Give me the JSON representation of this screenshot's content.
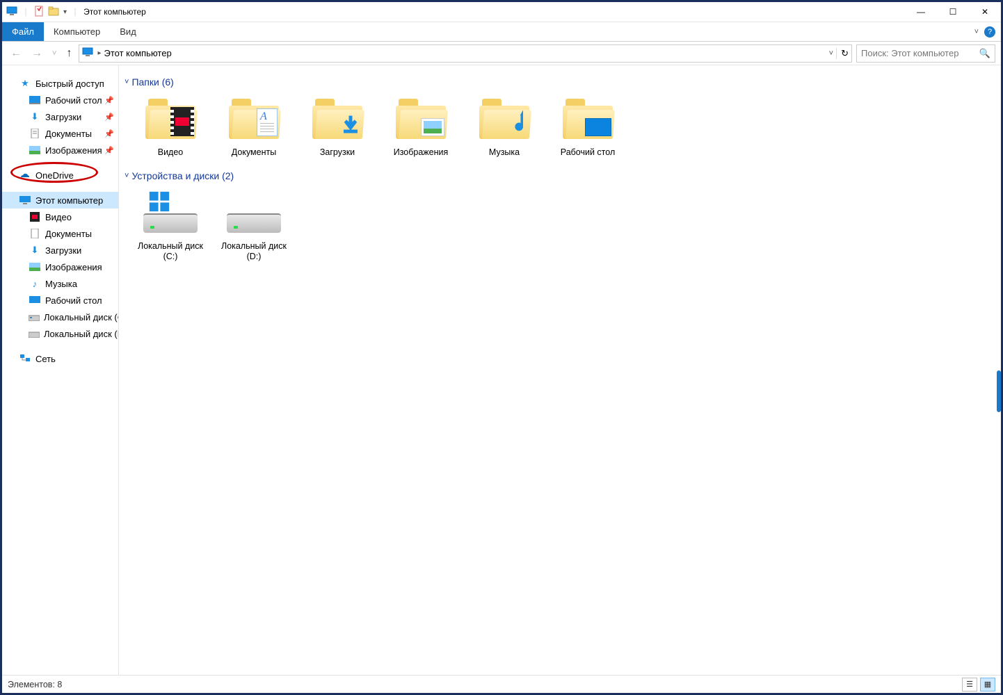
{
  "window": {
    "title": "Этот компьютер",
    "min": "—",
    "max": "☐",
    "close": "✕"
  },
  "ribbon": {
    "file": "Файл",
    "computer": "Компьютер",
    "view": "Вид"
  },
  "address": {
    "crumb": "Этот компьютер",
    "dropdown": "˅",
    "refresh": "↻"
  },
  "search": {
    "placeholder": "Поиск: Этот компьютер"
  },
  "sidebar": {
    "quick_access": "Быстрый доступ",
    "qa_items": [
      {
        "label": "Рабочий стол",
        "icon": "desktop"
      },
      {
        "label": "Загрузки",
        "icon": "download"
      },
      {
        "label": "Документы",
        "icon": "doc"
      },
      {
        "label": "Изображения",
        "icon": "image"
      }
    ],
    "onedrive": "OneDrive",
    "this_pc": "Этот компьютер",
    "pc_items": [
      {
        "label": "Видео",
        "icon": "video"
      },
      {
        "label": "Документы",
        "icon": "doc"
      },
      {
        "label": "Загрузки",
        "icon": "download"
      },
      {
        "label": "Изображения",
        "icon": "image"
      },
      {
        "label": "Музыка",
        "icon": "music"
      },
      {
        "label": "Рабочий стол",
        "icon": "desktop"
      },
      {
        "label": "Локальный диск (C",
        "icon": "drive"
      },
      {
        "label": "Локальный диск (D",
        "icon": "drive"
      }
    ],
    "network": "Сеть"
  },
  "content": {
    "section_folders": "Папки (6)",
    "folders": [
      {
        "label": "Видео"
      },
      {
        "label": "Документы"
      },
      {
        "label": "Загрузки"
      },
      {
        "label": "Изображения"
      },
      {
        "label": "Музыка"
      },
      {
        "label": "Рабочий стол"
      }
    ],
    "section_drives": "Устройства и диски (2)",
    "drives": [
      {
        "label": "Локальный диск (C:)"
      },
      {
        "label": "Локальный диск (D:)"
      }
    ]
  },
  "statusbar": {
    "count": "Элементов: 8"
  }
}
